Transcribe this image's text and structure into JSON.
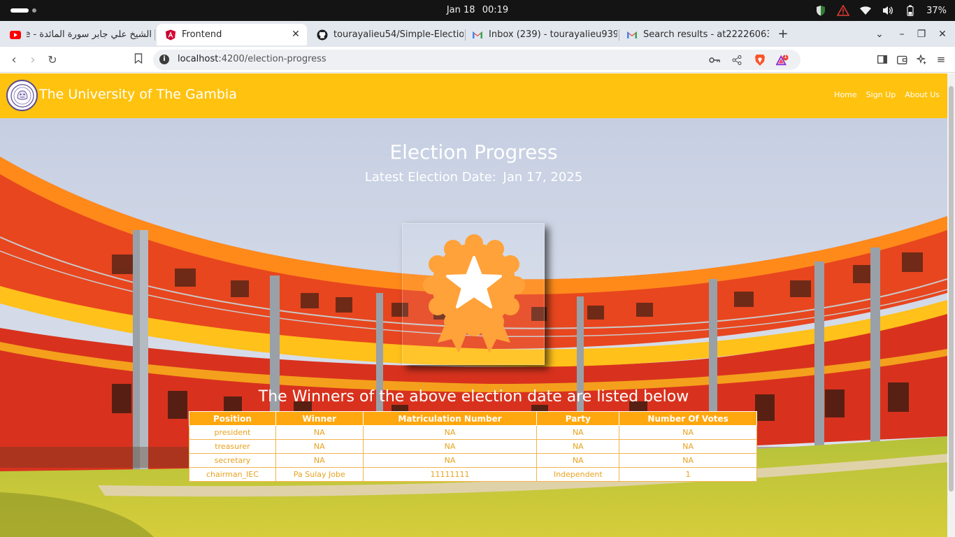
{
  "os": {
    "date": "Jan 18",
    "time": "00:19",
    "battery": "37%"
  },
  "browser": {
    "tabs": [
      {
        "title": "الشيخ علي جابر سورة المائدة - e",
        "icon": "youtube-icon"
      },
      {
        "title": "Frontend",
        "icon": "angular-icon",
        "active": true
      },
      {
        "title": "tourayalieu54/Simple-Electio",
        "icon": "github-icon"
      },
      {
        "title": "Inbox (239) - tourayalieu939",
        "icon": "gmail-icon"
      },
      {
        "title": "Search results - at22226063",
        "icon": "gmail-icon"
      }
    ],
    "url_host": "localhost",
    "url_rest": ":4200/election-progress",
    "brave_badge": "1"
  },
  "site": {
    "brand": "The University of The Gambia",
    "nav": {
      "home": "Home",
      "signup": "Sign Up",
      "about": "About Us"
    },
    "title": "Election Progress",
    "subtitle_prefix": "Latest Election Date:",
    "election_date": "Jan 17, 2025",
    "winners_heading": "The Winners of the above election date are listed below",
    "accent_color": "#ffc20e",
    "table_header_color": "#ffa70e"
  },
  "table": {
    "headers": [
      "Position",
      "Winner",
      "Matriculation Number",
      "Party",
      "Number Of Votes"
    ],
    "rows": [
      [
        "president",
        "NA",
        "NA",
        "NA",
        "NA"
      ],
      [
        "treasurer",
        "NA",
        "NA",
        "NA",
        "NA"
      ],
      [
        "secretary",
        "NA",
        "NA",
        "NA",
        "NA"
      ],
      [
        "chairman_IEC",
        "Pa Sulay Jobe",
        "11111111",
        "Independent",
        "1"
      ]
    ]
  }
}
